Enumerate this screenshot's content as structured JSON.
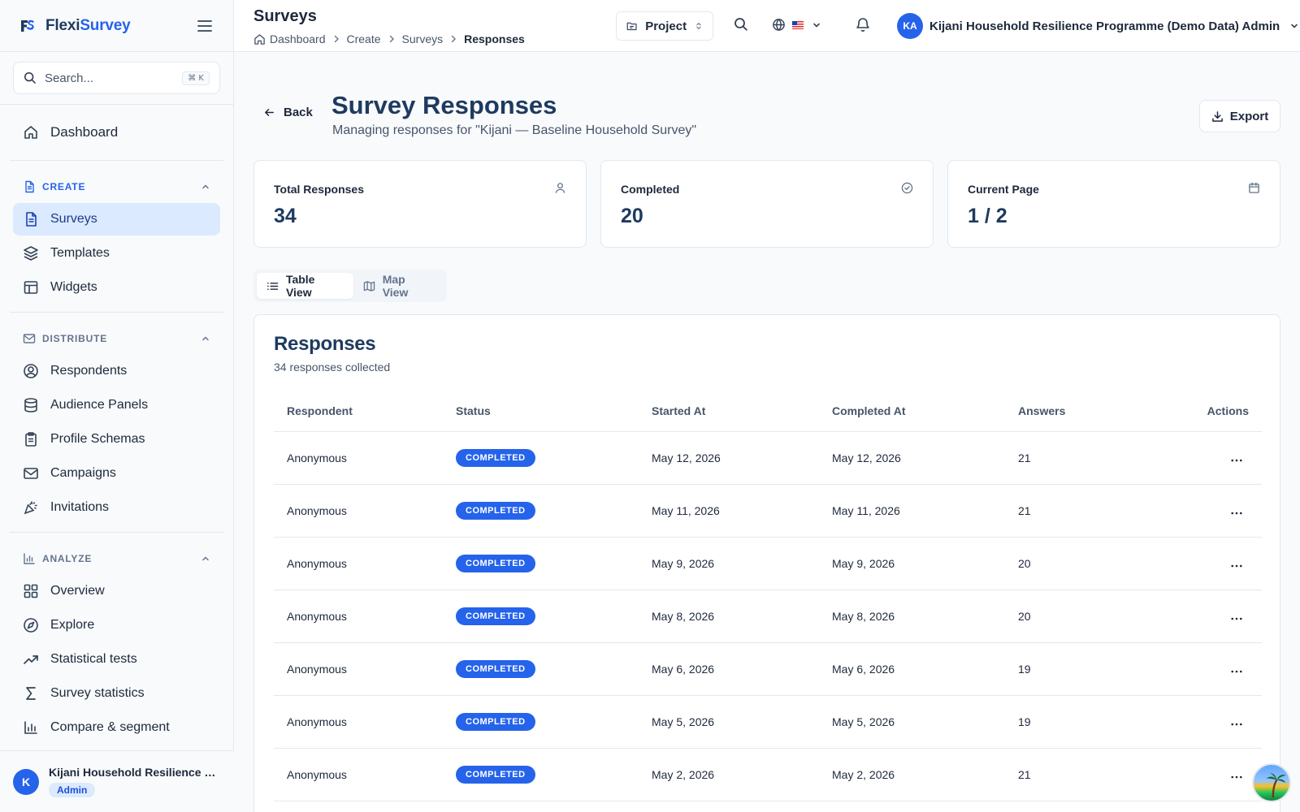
{
  "sidebar": {
    "brand": {
      "part1": "Flexi",
      "part2": "Survey"
    },
    "search": {
      "placeholder": "Search...",
      "shortcut": "⌘ K"
    },
    "dashboard": "Dashboard",
    "sections": {
      "create": {
        "title": "CREATE",
        "items": [
          "Surveys",
          "Templates",
          "Widgets"
        ]
      },
      "distribute": {
        "title": "DISTRIBUTE",
        "items": [
          "Respondents",
          "Audience Panels",
          "Profile Schemas",
          "Campaigns",
          "Invitations"
        ]
      },
      "analyze": {
        "title": "ANALYZE",
        "items": [
          "Overview",
          "Explore",
          "Statistical tests",
          "Survey statistics",
          "Compare & segment"
        ]
      }
    },
    "user": {
      "initial": "K",
      "name": "Kijani Household Resilience Programme (Demo Data) Admin",
      "role": "Admin"
    }
  },
  "header": {
    "title": "Surveys",
    "breadcrumb": [
      "Dashboard",
      "Create",
      "Surveys",
      "Responses"
    ],
    "project_label": "Project",
    "user_initials": "KA",
    "user_name": "Kijani Household Resilience Programme (Demo Data) Admin"
  },
  "page": {
    "back_label": "Back",
    "title": "Survey Responses",
    "subtitle": "Managing responses for \"Kijani — Baseline Household Survey\"",
    "export_label": "Export"
  },
  "stats": [
    {
      "label": "Total Responses",
      "value": "34",
      "icon": "user-icon"
    },
    {
      "label": "Completed",
      "value": "20",
      "icon": "check-circle-icon"
    },
    {
      "label": "Current Page",
      "value": "1 / 2",
      "icon": "calendar-icon"
    }
  ],
  "view_tabs": {
    "table": "Table View",
    "map": "Map View",
    "selected": "Table View"
  },
  "table": {
    "title": "Responses",
    "subtitle": "34 responses collected",
    "columns": [
      "Respondent",
      "Status",
      "Started At",
      "Completed At",
      "Answers",
      "Actions"
    ],
    "rows": [
      {
        "respondent": "Anonymous",
        "status": "COMPLETED",
        "started": "May 12, 2026",
        "completed": "May 12, 2026",
        "answers": "21"
      },
      {
        "respondent": "Anonymous",
        "status": "COMPLETED",
        "started": "May 11, 2026",
        "completed": "May 11, 2026",
        "answers": "21"
      },
      {
        "respondent": "Anonymous",
        "status": "COMPLETED",
        "started": "May 9, 2026",
        "completed": "May 9, 2026",
        "answers": "20"
      },
      {
        "respondent": "Anonymous",
        "status": "COMPLETED",
        "started": "May 8, 2026",
        "completed": "May 8, 2026",
        "answers": "20"
      },
      {
        "respondent": "Anonymous",
        "status": "COMPLETED",
        "started": "May 6, 2026",
        "completed": "May 6, 2026",
        "answers": "19"
      },
      {
        "respondent": "Anonymous",
        "status": "COMPLETED",
        "started": "May 5, 2026",
        "completed": "May 5, 2026",
        "answers": "19"
      },
      {
        "respondent": "Anonymous",
        "status": "COMPLETED",
        "started": "May 2, 2026",
        "completed": "May 2, 2026",
        "answers": "21"
      }
    ]
  },
  "colors": {
    "accent": "#2563eb",
    "accent_light": "#dbeafe",
    "heading": "#1e3a5f",
    "border": "#e2e8f0"
  }
}
